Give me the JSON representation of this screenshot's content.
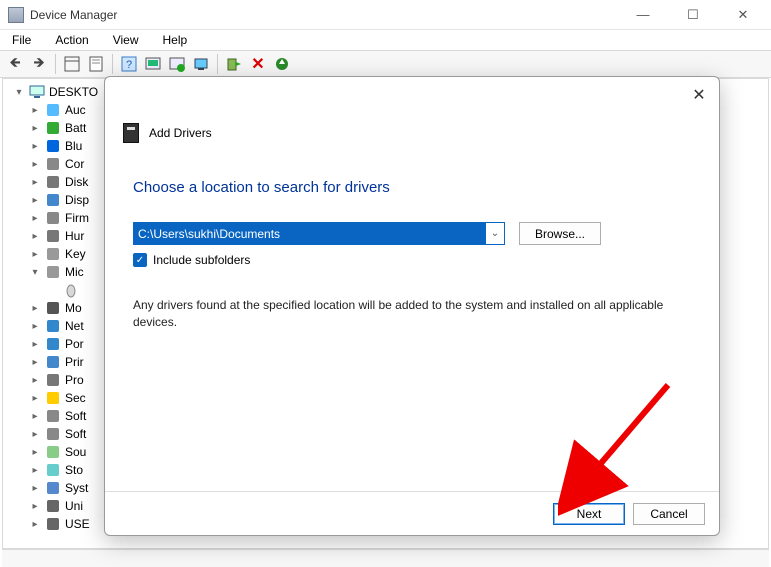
{
  "window": {
    "title": "Device Manager"
  },
  "menubar": {
    "file": "File",
    "action": "Action",
    "view": "View",
    "help": "Help"
  },
  "tree": {
    "root": "DESKTO",
    "items": [
      {
        "label": "Auc",
        "exp": ">"
      },
      {
        "label": "Batt",
        "exp": ">"
      },
      {
        "label": "Blu",
        "exp": ">"
      },
      {
        "label": "Cor",
        "exp": ">"
      },
      {
        "label": "Disk",
        "exp": ">"
      },
      {
        "label": "Disp",
        "exp": ">"
      },
      {
        "label": "Firm",
        "exp": ">"
      },
      {
        "label": "Hur",
        "exp": ">"
      },
      {
        "label": "Key",
        "exp": ">"
      },
      {
        "label": "Mic",
        "exp": "v",
        "child": true
      },
      {
        "label": "Mo",
        "exp": ">"
      },
      {
        "label": "Net",
        "exp": ">"
      },
      {
        "label": "Por",
        "exp": ">"
      },
      {
        "label": "Prir",
        "exp": ">"
      },
      {
        "label": "Pro",
        "exp": ">"
      },
      {
        "label": "Sec",
        "exp": ">"
      },
      {
        "label": "Soft",
        "exp": ">"
      },
      {
        "label": "Soft",
        "exp": ">"
      },
      {
        "label": "Sou",
        "exp": ">"
      },
      {
        "label": "Sto",
        "exp": ">"
      },
      {
        "label": "Syst",
        "exp": ">"
      },
      {
        "label": "Uni",
        "exp": ">"
      },
      {
        "label": "USE",
        "exp": ">"
      }
    ]
  },
  "dialog": {
    "header": "Add Drivers",
    "title": "Choose a location to search for drivers",
    "path": "C:\\Users\\sukhi\\Documents",
    "browse": "Browse...",
    "include_subfolders": "Include subfolders",
    "info": "Any drivers found at the specified location will be added to the system and installed on all applicable devices.",
    "next": "Next",
    "cancel": "Cancel"
  }
}
